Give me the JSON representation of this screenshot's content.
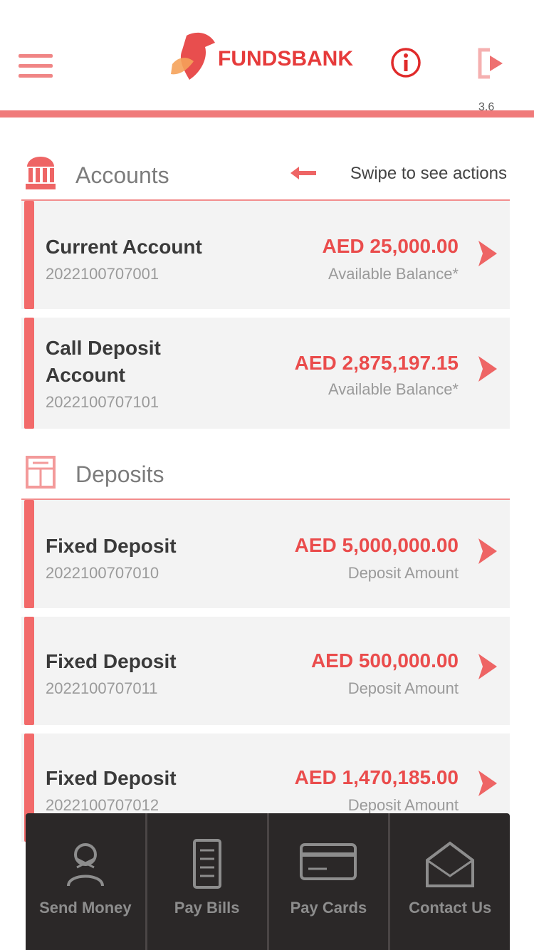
{
  "header": {
    "logo_text": "FUNDSBANK",
    "version": "3.6"
  },
  "sections": {
    "accounts": {
      "title": "Accounts",
      "swipe_hint": "Swipe to see actions"
    },
    "deposits": {
      "title": "Deposits"
    }
  },
  "accounts": [
    {
      "title": "Current Account",
      "number": "2022100707001",
      "amount": "AED 25,000.00",
      "sub": "Available Balance*"
    },
    {
      "title": "Call Deposit Account",
      "number": "2022100707101",
      "amount": "AED 2,875,197.15",
      "sub": "Available Balance*"
    }
  ],
  "deposits": [
    {
      "title": "Fixed Deposit",
      "number": "2022100707010",
      "amount": "AED 5,000,000.00",
      "sub": "Deposit Amount"
    },
    {
      "title": "Fixed Deposit",
      "number": "2022100707011",
      "amount": "AED 500,000.00",
      "sub": "Deposit Amount"
    },
    {
      "title": "Fixed Deposit",
      "number": "2022100707012",
      "amount": "AED 1,470,185.00",
      "sub": "Deposit Amount"
    }
  ],
  "actions": [
    {
      "label": "Send Money",
      "icon": "send-money-icon"
    },
    {
      "label": "Pay Bills",
      "icon": "pay-bills-icon"
    },
    {
      "label": "Pay Cards",
      "icon": "pay-cards-icon"
    },
    {
      "label": "Contact Us",
      "icon": "contact-us-icon"
    }
  ],
  "colors": {
    "accent": "#ea4c4c",
    "stripe": "#f26a6a",
    "card_bg": "#f3f3f3",
    "action_bar": "#2b2828"
  }
}
